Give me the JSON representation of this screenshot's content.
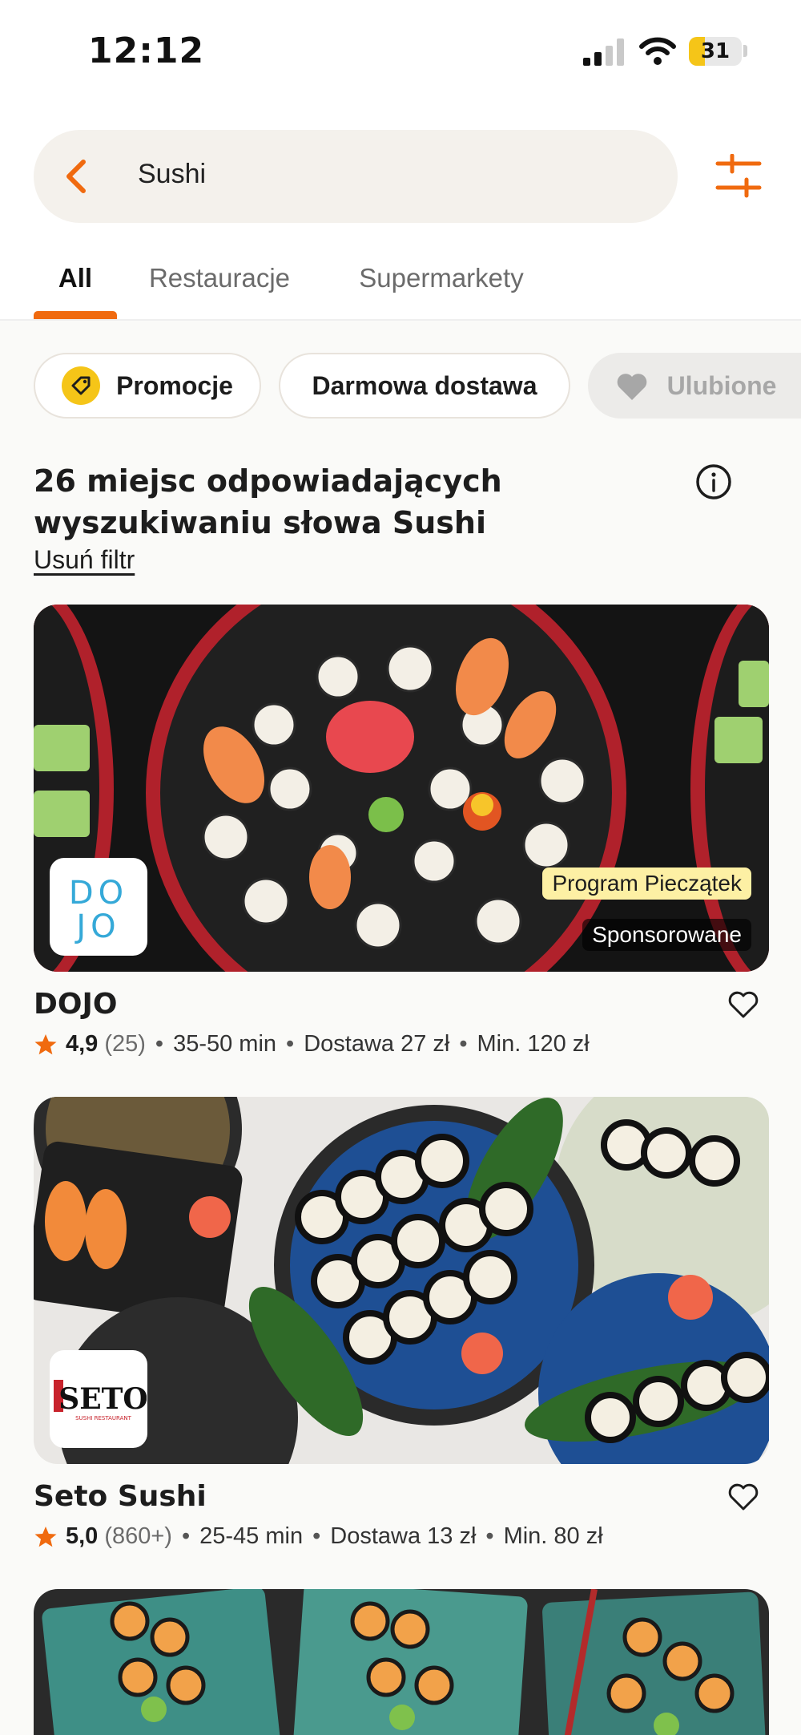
{
  "status_bar": {
    "time": "12:12",
    "battery": "31",
    "battery_level": 0.31
  },
  "search": {
    "value": "Sushi"
  },
  "tabs": [
    {
      "label": "All",
      "active": true
    },
    {
      "label": "Restauracje",
      "active": false
    },
    {
      "label": "Supermarkety",
      "active": false
    }
  ],
  "chips": [
    {
      "label": "Promocje",
      "icon": "tag-icon"
    },
    {
      "label": "Darmowa dostawa",
      "icon": ""
    },
    {
      "label": "Ulubione",
      "icon": "heart-icon",
      "disabled": true
    }
  ],
  "results": {
    "title": "26 miejsc odpowiadających wyszukiwaniu słowa Sushi",
    "remove_filter": "Usuń filtr"
  },
  "restaurants": [
    {
      "name": "DOJO",
      "logo_text": "DOJO",
      "badge": "Program Pieczątek",
      "sponsored": "Sponsorowane",
      "rating": "4,9",
      "reviews": "(25)",
      "time": "35-50 min",
      "delivery": "Dostawa 27 zł",
      "min_order": "Min. 120 zł"
    },
    {
      "name": "Seto Sushi",
      "logo_text": "SETO",
      "logo_subtext": "SUSHI RESTAURANT",
      "rating": "5,0",
      "reviews": "(860+)",
      "time": "25-45 min",
      "delivery": "Dostawa 13 zł",
      "min_order": "Min. 80 zł"
    }
  ],
  "colors": {
    "accent": "#f06a0f",
    "star": "#f06a0f",
    "badge": "#fdf0a4"
  }
}
